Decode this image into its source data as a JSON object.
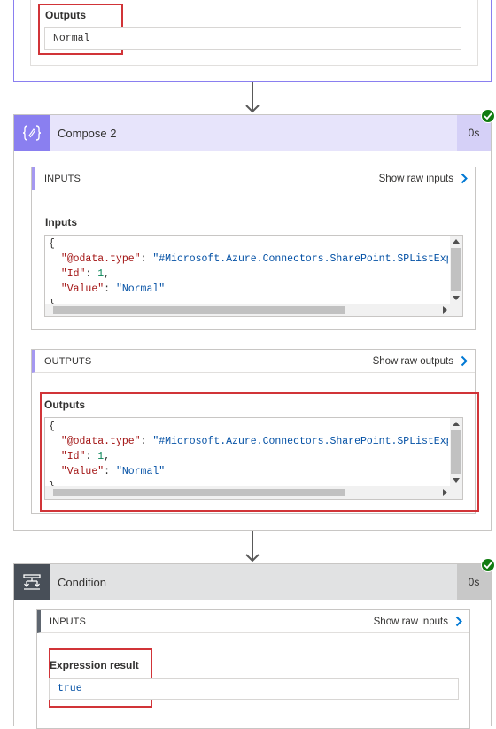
{
  "top_card": {
    "outputs_label": "Outputs",
    "outputs_value": "Normal"
  },
  "compose": {
    "title": "Compose 2",
    "duration": "0s",
    "accent_color": "#8a7ff0",
    "header_bg": "#e7e4fb",
    "icon": "compose-braces-icon",
    "inputs_section": {
      "heading": "INPUTS",
      "raw_link": "Show raw inputs",
      "field_label": "Inputs",
      "code_lines": [
        "{",
        "  \"@odata.type\": \"#Microsoft.Azure.Connectors.SharePoint.SPListExpa",
        "  \"Id\": 1,",
        "  \"Value\": \"Normal\"",
        "}"
      ]
    },
    "outputs_section": {
      "heading": "OUTPUTS",
      "raw_link": "Show raw outputs",
      "field_label": "Outputs",
      "code_lines": [
        "{",
        "  \"@odata.type\": \"#Microsoft.Azure.Connectors.SharePoint.SPListExpa",
        "  \"Id\": 1,",
        "  \"Value\": \"Normal\"",
        "}"
      ]
    }
  },
  "condition": {
    "title": "Condition",
    "duration": "0s",
    "accent_color": "#484f58",
    "header_bg": "#e1e2e3",
    "icon": "condition-branch-icon",
    "inputs_section": {
      "heading": "INPUTS",
      "raw_link": "Show raw inputs",
      "field_label": "Expression result",
      "field_value": "true"
    }
  },
  "status": {
    "succeeded_icon": "check-circle-icon",
    "success_color": "#107c10",
    "link_chevron_color": "#0078d4",
    "highlight_color": "#d13438"
  }
}
